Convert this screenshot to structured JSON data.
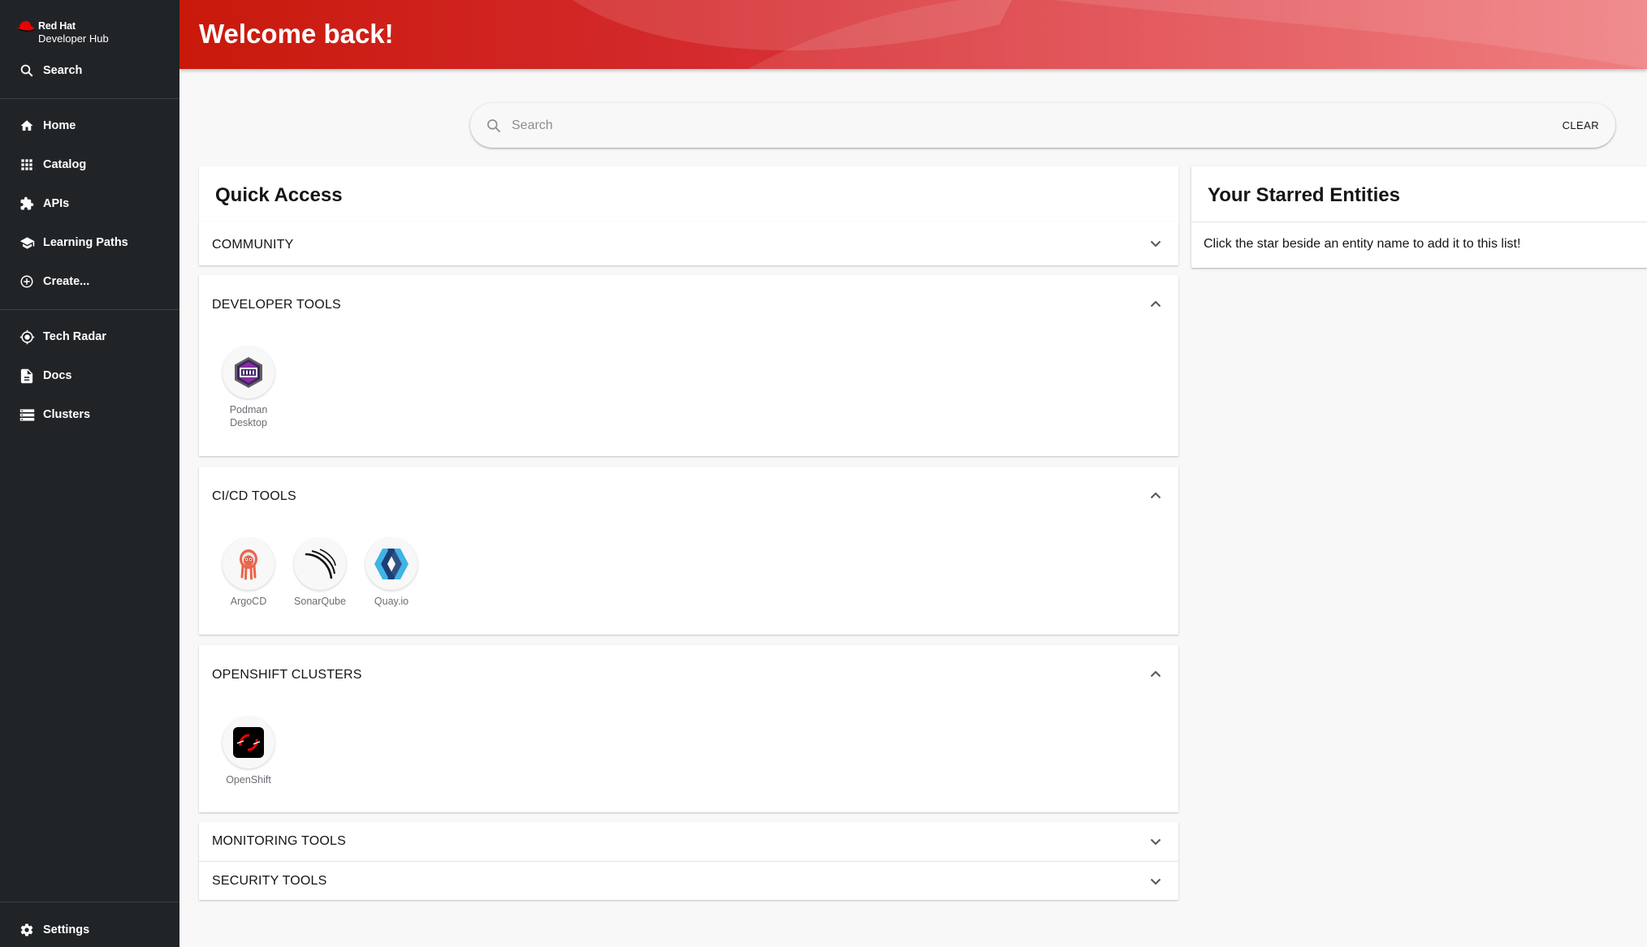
{
  "sidebar": {
    "logo": {
      "brand": "Red Hat",
      "product": "Developer Hub"
    },
    "search_label": "Search",
    "items": [
      {
        "label": "Home",
        "icon": "home-icon"
      },
      {
        "label": "Catalog",
        "icon": "grid-icon"
      },
      {
        "label": "APIs",
        "icon": "puzzle-icon"
      },
      {
        "label": "Learning Paths",
        "icon": "school-icon"
      },
      {
        "label": "Create...",
        "icon": "add-circle-icon"
      },
      {
        "label": "Tech Radar",
        "icon": "radar-icon"
      },
      {
        "label": "Docs",
        "icon": "document-icon"
      },
      {
        "label": "Clusters",
        "icon": "storage-icon"
      }
    ],
    "settings_label": "Settings"
  },
  "header": {
    "title": "Welcome back!"
  },
  "search": {
    "placeholder": "Search",
    "clear_label": "CLEAR"
  },
  "quick_access": {
    "title": "Quick Access",
    "sections": [
      {
        "title": "COMMUNITY",
        "expanded": false,
        "items": []
      },
      {
        "title": "DEVELOPER TOOLS",
        "expanded": true,
        "items": [
          {
            "label": "Podman Desktop",
            "icon": "podman-icon"
          }
        ]
      },
      {
        "title": "CI/CD TOOLS",
        "expanded": true,
        "items": [
          {
            "label": "ArgoCD",
            "icon": "argocd-icon"
          },
          {
            "label": "SonarQube",
            "icon": "sonarqube-icon"
          },
          {
            "label": "Quay.io",
            "icon": "quay-icon"
          }
        ]
      },
      {
        "title": "OPENSHIFT CLUSTERS",
        "expanded": true,
        "items": [
          {
            "label": "OpenShift",
            "icon": "openshift-icon"
          }
        ]
      },
      {
        "title": "MONITORING TOOLS",
        "expanded": false,
        "items": []
      },
      {
        "title": "SECURITY TOOLS",
        "expanded": false,
        "items": []
      }
    ]
  },
  "starred": {
    "title": "Your Starred Entities",
    "empty_text": "Click the star beside an entity name to add it to this list!"
  },
  "colors": {
    "sidebar_bg": "#212427",
    "brand_red": "#ee0000",
    "header_start": "#c9190b",
    "header_end": "#ee7173"
  }
}
